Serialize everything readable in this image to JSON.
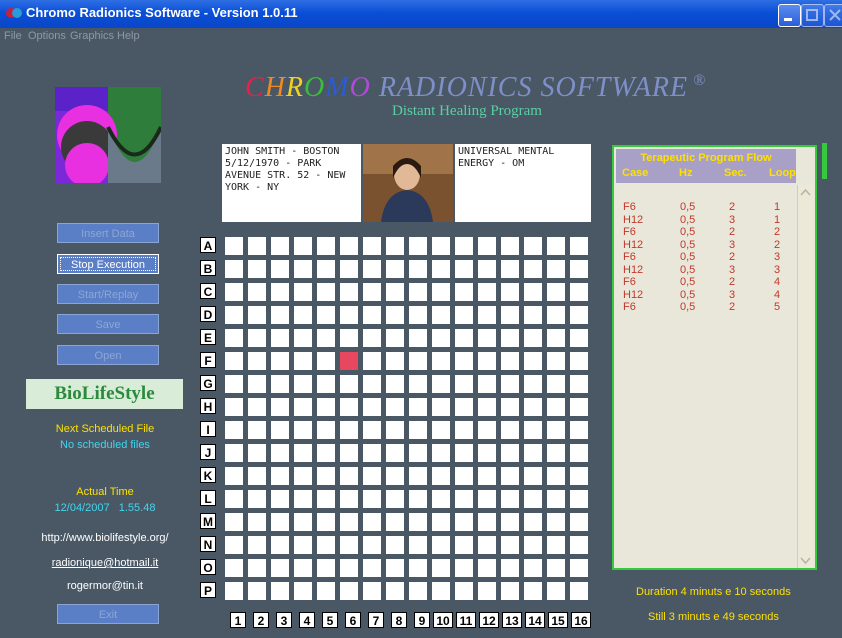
{
  "window": {
    "title": "Chromo Radionics Software - Version 1.0.11"
  },
  "menu": [
    "File",
    "Options",
    "Graphics",
    "Help"
  ],
  "header": {
    "brand_letters": [
      {
        "ch": "C",
        "color": "#e8204a"
      },
      {
        "ch": "H",
        "color": "#f08a20"
      },
      {
        "ch": "R",
        "color": "#f2d21b"
      },
      {
        "ch": "O",
        "color": "#3bbf3b"
      },
      {
        "ch": "M",
        "color": "#2a5bd8"
      },
      {
        "ch": "O",
        "color": "#b04ad8"
      },
      {
        "ch": " RADIONICS SOFTWARE",
        "color": "#7f8fc8"
      },
      {
        "ch": " ®",
        "color": "#7f8fc8"
      }
    ],
    "subtitle": "Distant Healing Program"
  },
  "sidebar": {
    "buttons": [
      {
        "label": "Insert Data",
        "active": false
      },
      {
        "label": "Stop Execution",
        "active": true
      },
      {
        "label": "Start/Replay",
        "active": false
      },
      {
        "label": "Save",
        "active": false
      },
      {
        "label": "Open",
        "active": false
      }
    ],
    "biolife": "BioLifeStyle",
    "next_file_label": "Next Scheduled File",
    "next_file_value": "No scheduled files",
    "actual_time_label": "Actual Time",
    "actual_time_value": "12/04/2007   1.55.48",
    "website": "http://www.biolifestyle.org/",
    "email1": "radionique@hotmail.it",
    "email2": "rogermor@tin.it",
    "exit_label": "Exit"
  },
  "subject": {
    "name_address": "JOHN SMITH - BOSTON 5/12/1970 - PARK AVENUE STR. 52 - NEW YORK - NY",
    "energy": "UNIVERSAL MENTAL ENERGY - OM"
  },
  "grid": {
    "rows": [
      "A",
      "B",
      "C",
      "D",
      "E",
      "F",
      "G",
      "H",
      "I",
      "J",
      "K",
      "L",
      "M",
      "N",
      "O",
      "P"
    ],
    "cols": [
      "1",
      "2",
      "3",
      "4",
      "5",
      "6",
      "7",
      "8",
      "9",
      "10",
      "11",
      "12",
      "13",
      "14",
      "15",
      "16"
    ],
    "active_cell": {
      "row": "F",
      "col": "6"
    },
    "active_color": "#e8485f"
  },
  "flow_panel": {
    "title": "Terapeutic Program Flow",
    "columns": [
      "Case",
      "Hz",
      "Sec.",
      "Loop"
    ],
    "rows": [
      [
        "F6",
        "0,5",
        "2",
        "1"
      ],
      [
        "H12",
        "0,5",
        "3",
        "1"
      ],
      [
        "F6",
        "0,5",
        "2",
        "2"
      ],
      [
        "H12",
        "0,5",
        "3",
        "2"
      ],
      [
        "F6",
        "0,5",
        "2",
        "3"
      ],
      [
        "H12",
        "0,5",
        "3",
        "3"
      ],
      [
        "F6",
        "0,5",
        "2",
        "4"
      ],
      [
        "H12",
        "0,5",
        "3",
        "4"
      ],
      [
        "F6",
        "0,5",
        "2",
        "5"
      ]
    ],
    "duration": "Duration  4  minuts e 10  seconds",
    "remaining": "Still  3  minuts e 49  seconds"
  },
  "colors": {
    "background": "#4a5866",
    "accent_green": "#37c93d",
    "label_yellow": "#ffe000",
    "label_cyan": "#3fd6f0"
  }
}
